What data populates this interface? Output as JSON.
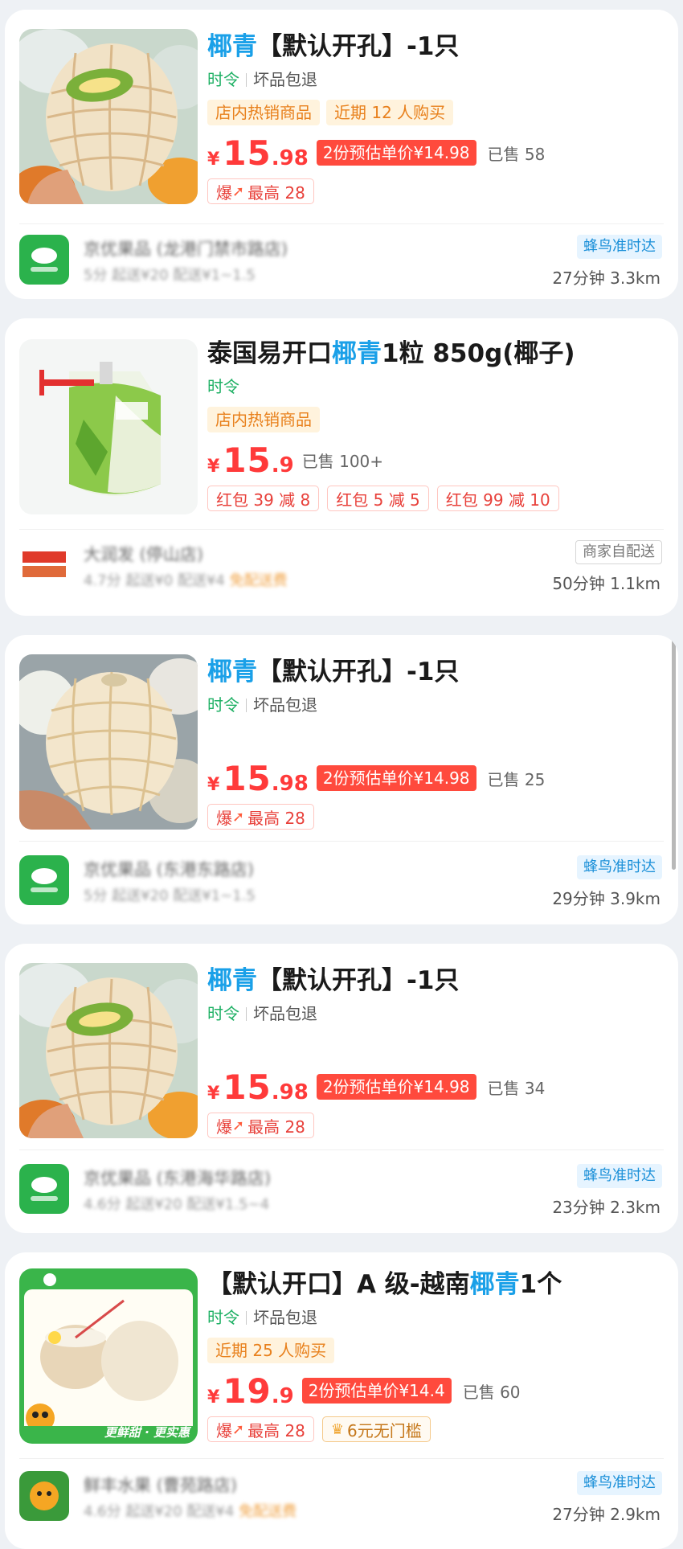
{
  "colors": {
    "title_highlight": "#1aa0e8",
    "price": "#ff3a3a",
    "estimate_badge_bg": "#ff4a3d",
    "seasonal_text": "#1eb064",
    "orange_tag_text": "#e8801c",
    "orange_tag_bg": "#fff3dd",
    "delivery_blue": "#1a8fd8"
  },
  "products": [
    {
      "title_pre": "",
      "title_hl": "椰青",
      "title_post": "【默认开孔】-1只",
      "seasonal": "时令",
      "return_policy": "坏品包退",
      "tags": [
        "店内热销商品",
        "近期 12 人购买"
      ],
      "price_yen": "¥",
      "price_int": "15",
      "price_dec": ".98",
      "estimate": "2份预估单价¥14.98",
      "sold": "已售 58",
      "badges": [
        "最高 28"
      ],
      "badge_fire": "爆",
      "store_name": "京优果品 (龙港门禁市路店)",
      "store_meta": "5分 起送¥20 配送¥1~1.5",
      "store_meta_orange": "",
      "delivery": "蜂鸟准时达",
      "eta": "27分钟 3.3km",
      "image_icon": "coconut-net-icon"
    },
    {
      "title_pre": "泰国易开口",
      "title_hl": "椰青",
      "title_post": "1粒 850g(椰子)",
      "seasonal": "时令",
      "return_policy": "",
      "tags": [
        "店内热销商品"
      ],
      "price_yen": "¥",
      "price_int": "15",
      "price_dec": ".9",
      "estimate": "",
      "sold": "已售 100+",
      "badges": [
        "红包 39 减 8",
        "红包 5 减 5",
        "红包 99 减 10"
      ],
      "badge_fire": "",
      "store_name": "大润发 (停山店)",
      "store_meta": "4.7分 起送¥0 配送¥4",
      "store_meta_orange": "免配送费",
      "delivery": "商家自配送",
      "eta": "50分钟 1.1km",
      "image_icon": "thai-coconut-icon"
    },
    {
      "title_pre": "",
      "title_hl": "椰青",
      "title_post": "【默认开孔】-1只",
      "seasonal": "时令",
      "return_policy": "坏品包退",
      "tags": [],
      "price_yen": "¥",
      "price_int": "15",
      "price_dec": ".98",
      "estimate": "2份预估单价¥14.98",
      "sold": "已售 25",
      "badges": [
        "最高 28"
      ],
      "badge_fire": "爆",
      "store_name": "京优果品 (东港东路店)",
      "store_meta": "5分 起送¥20 配送¥1~1.5",
      "store_meta_orange": "",
      "delivery": "蜂鸟准时达",
      "eta": "29分钟 3.9km",
      "image_icon": "coconut-hand-icon"
    },
    {
      "title_pre": "",
      "title_hl": "椰青",
      "title_post": "【默认开孔】-1只",
      "seasonal": "时令",
      "return_policy": "坏品包退",
      "tags": [],
      "price_yen": "¥",
      "price_int": "15",
      "price_dec": ".98",
      "estimate": "2份预估单价¥14.98",
      "sold": "已售 34",
      "badges": [
        "最高 28"
      ],
      "badge_fire": "爆",
      "store_name": "京优果品 (东港海华路店)",
      "store_meta": "4.6分 起送¥20 配送¥1.5~4",
      "store_meta_orange": "",
      "delivery": "蜂鸟准时达",
      "eta": "23分钟 2.3km",
      "image_icon": "coconut-net-icon"
    },
    {
      "title_pre": "【默认开口】A 级-越南",
      "title_hl": "椰青",
      "title_post": "1个",
      "seasonal": "时令",
      "return_policy": "坏品包退",
      "tags": [
        "近期 25 人购买"
      ],
      "price_yen": "¥",
      "price_int": "19",
      "price_dec": ".9",
      "estimate": "2份预估单价¥14.4",
      "sold": "已售 60",
      "badges": [
        "最高 28"
      ],
      "badge_fire": "爆",
      "gold_badge": "6元无门槛",
      "store_name": "鲜丰水果 (曹苑路店)",
      "store_meta": "4.6分 起送¥20 配送¥4",
      "store_meta_orange": "免配送费",
      "delivery": "蜂鸟准时达",
      "eta": "27分钟 2.9km",
      "image_icon": "opened-coconut-icon",
      "image_caption": "更鲜甜 · 更实惠"
    }
  ]
}
